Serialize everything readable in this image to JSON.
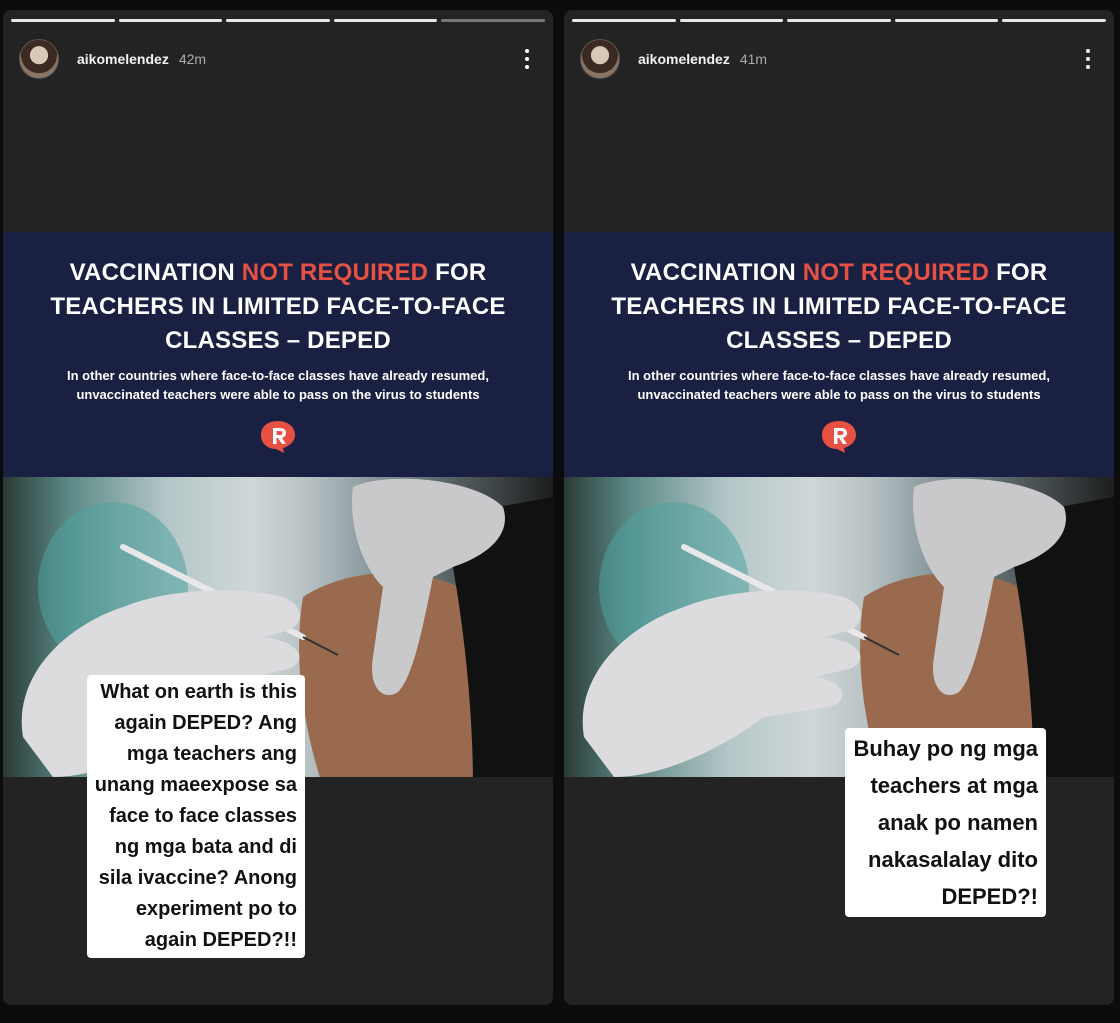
{
  "stories": [
    {
      "username": "aikomelendez",
      "time": "42m",
      "progress_total": 5,
      "progress_done": 4,
      "headline": {
        "line1_pre": "VACCINATION ",
        "line1_red": "NOT REQUIRED",
        "line1_post": " FOR",
        "line2": "TEACHERS IN LIMITED FACE-TO-FACE",
        "line3": "CLASSES – DEPED"
      },
      "subtext": "In other countries where face-to-face classes have already resumed, unvaccinated teachers were able to pass on the virus to students",
      "caption_lines": [
        "What on earth is this",
        "again DEPED? Ang",
        "mga teachers ang",
        "unang maeexpose sa",
        "face to face classes",
        "ng mga bata and di",
        "sila ivaccine? Anong",
        "experiment po to",
        "again DEPED?!!"
      ]
    },
    {
      "username": "aikomelendez",
      "time": "41m",
      "progress_total": 5,
      "progress_done": 5,
      "headline": {
        "line1_pre": "VACCINATION ",
        "line1_red": "NOT REQUIRED",
        "line1_post": " FOR",
        "line2": "TEACHERS IN LIMITED FACE-TO-FACE",
        "line3": "CLASSES – DEPED"
      },
      "subtext": "In other countries where face-to-face classes have already resumed, unvaccinated teachers were able to pass on the virus to students",
      "caption_lines": [
        "Buhay po ng mga",
        "teachers at mga",
        "anak po namen",
        "nakasalalay dito",
        "DEPED?!"
      ]
    }
  ],
  "colors": {
    "banner_bg": "#1a2042",
    "accent_red": "#e65143",
    "story_bg": "#232323"
  },
  "icons": [
    "more-options-icon",
    "rappler-logo-icon"
  ]
}
